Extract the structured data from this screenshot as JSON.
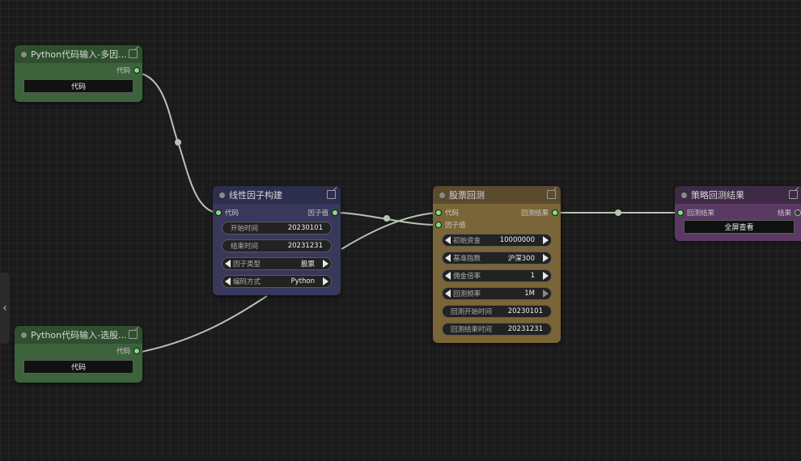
{
  "nodes": {
    "python_input_1": {
      "title": "Python代码输入-多因...",
      "output_label": "代码",
      "button_label": "代码"
    },
    "python_input_2": {
      "title": "Python代码输入-选股...",
      "output_label": "代码",
      "button_label": "代码"
    },
    "linear_factor": {
      "title": "线性因子构建",
      "input_label": "代码",
      "output_label": "因子值",
      "widgets": [
        {
          "label": "开始时间",
          "value": "20230101"
        },
        {
          "label": "结束时间",
          "value": "20231231"
        },
        {
          "label": "因子类型",
          "value": "股票"
        },
        {
          "label": "编码方式",
          "value": "Python"
        }
      ]
    },
    "stock_backtest": {
      "title": "股票回测",
      "inputs": [
        "代码",
        "因子值"
      ],
      "output_label": "回测结果",
      "widgets": [
        {
          "label": "初始资金",
          "value": "10000000"
        },
        {
          "label": "基准指数",
          "value": "沪深300"
        },
        {
          "label": "佣金倍率",
          "value": "1"
        },
        {
          "label": "回测频率",
          "value": "1M"
        },
        {
          "label": "回测开始时间",
          "value": "20230101"
        },
        {
          "label": "回测结束时间",
          "value": "20231231"
        }
      ]
    },
    "strategy_result": {
      "title": "策略回测结果",
      "input_label": "回测结果",
      "output_label": "结果",
      "button_label": "全屏查看"
    }
  },
  "sidebar": {
    "collapse_icon": "chevron-left-icon",
    "collapse_glyph": "‹"
  },
  "colors": {
    "canvas_bg": "#1b1b1b",
    "green_node_title": "#2f4f2f",
    "green_node_body": "#3c633c",
    "blue_node_title": "#2d2d4d",
    "blue_node_body": "#38385c",
    "brown_node_title": "#5a4a2e",
    "brown_node_body": "#7a6538",
    "purple_node_title": "#3e2a44",
    "purple_node_body": "#5a3a63",
    "link": "#b7c4b2",
    "slot_active": "#7ee27e"
  }
}
